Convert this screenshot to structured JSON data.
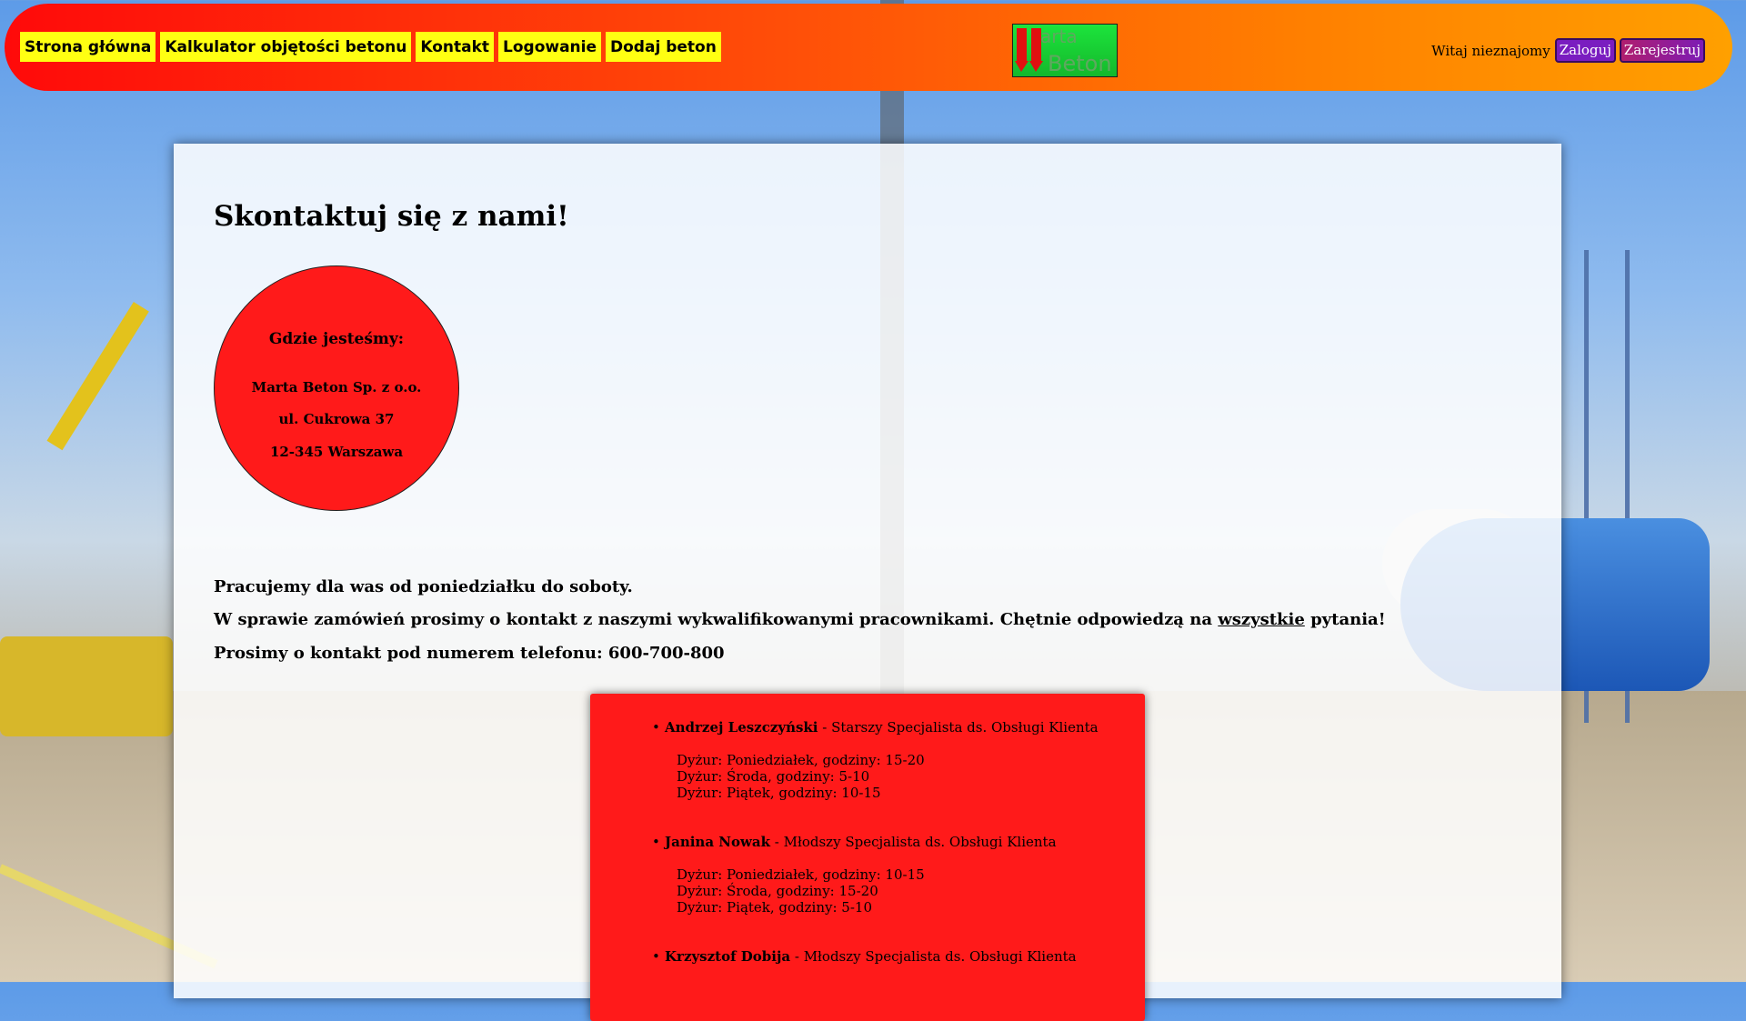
{
  "nav": [
    {
      "label": "Strona główna"
    },
    {
      "label": "Kalkulator objętości betonu"
    },
    {
      "label": "Kontakt"
    },
    {
      "label": "Logowanie"
    },
    {
      "label": "Dodaj beton"
    }
  ],
  "logo": {
    "line1": "arta",
    "line2": "Beton"
  },
  "user": {
    "greeting": "Witaj nieznajomy",
    "login_label": "Zaloguj",
    "register_label": "Zarejestruj"
  },
  "page": {
    "title": "Skontaktuj się z nami!"
  },
  "location": {
    "heading": "Gdzie jesteśmy:",
    "company": "Marta Beton Sp. z o.o.",
    "street": "ul. Cukrowa 37",
    "city": "12-345 Warszawa"
  },
  "info": {
    "line1": "Pracujemy dla was od poniedziałku do soboty.",
    "line2_before": "W sprawie zamówień prosimy o kontakt z naszymi wykwalifikowanymi pracownikami. Chętnie odpowiedzą na",
    "line2_link": "wszystkie",
    "line2_after": "pytania!",
    "line3": "Prosimy o kontakt pod numerem telefonu: 600-700-800"
  },
  "staff": [
    {
      "bullet": "•",
      "name": "Andrzej Leszczyński",
      "role": " - Starszy Specjalista ds. Obsługi Klienta",
      "shifts": [
        "Dyżur: Poniedziałek, godziny: 15-20",
        "Dyżur: Środa, godziny: 5-10",
        "Dyżur: Piątek, godziny: 10-15"
      ]
    },
    {
      "bullet": "•",
      "name": "Janina Nowak",
      "role": " - Młodszy Specjalista ds. Obsługi Klienta",
      "shifts": [
        "Dyżur: Poniedziałek, godziny: 10-15",
        "Dyżur: Środa, godziny: 15-20",
        "Dyżur: Piątek, godziny: 5-10"
      ]
    },
    {
      "bullet": "•",
      "name": "Krzysztof Dobija",
      "role": " - Młodszy Specjalista ds. Obsługi Klienta",
      "shifts": []
    }
  ]
}
